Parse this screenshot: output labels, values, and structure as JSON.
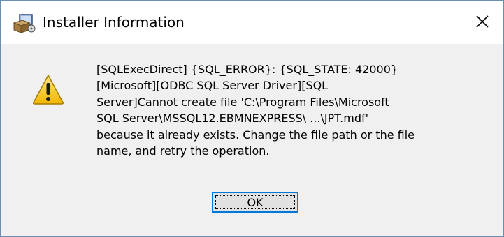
{
  "window": {
    "title": "Installer Information",
    "app_icon": "installer-icon",
    "close_icon": "close-icon"
  },
  "message": {
    "icon": "warning-icon",
    "lines": [
      "[SQLExecDirect] {SQL_ERROR}: {SQL_STATE: 42000}",
      "[Microsoft][ODBC SQL Server Driver][SQL",
      "Server]Cannot create file 'C:\\Program Files\\Microsoft",
      "SQL Server\\MSSQL12.EBMNEXPRESS\\ ...\\JPT.mdf'",
      "because it already exists. Change the file path or the file",
      "name, and retry the operation."
    ]
  },
  "buttons": {
    "ok_label": "OK"
  },
  "colors": {
    "accent": "#0078d7",
    "warning": "#f5c400",
    "content_bg": "#f0f0f0"
  }
}
